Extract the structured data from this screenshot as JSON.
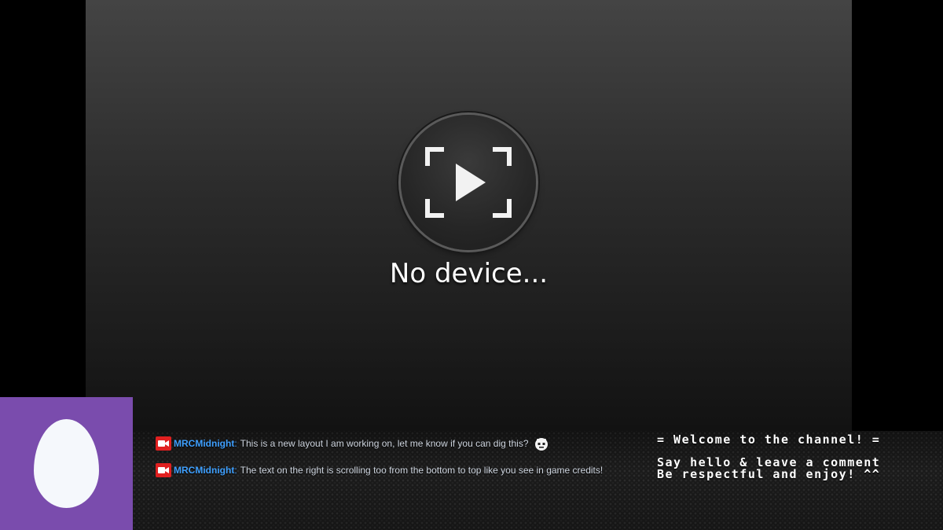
{
  "player": {
    "status_text": "No device..."
  },
  "chat": {
    "messages": [
      {
        "username": "MRCMidnight",
        "separator": ":",
        "text": "This is a new layout I am working on, let me know if you can dig this?",
        "emote": "robot-face-emote"
      },
      {
        "username": "MRCMidnight",
        "separator": ":",
        "text": "The text on the right is scrolling too from the bottom to top like you see in game credits!"
      }
    ]
  },
  "scroller": {
    "line1": "= Welcome to the channel! =",
    "line2": "Say hello & leave a comment",
    "line3": "Be respectful and enjoy! ^^"
  },
  "colors": {
    "webcam_bg": "#7a4cad",
    "username": "#3fa0ff",
    "badge": "#e02020"
  },
  "icons": {
    "play": "play-icon",
    "focus_frame": "focus-frame-icon",
    "camera": "video-camera-icon",
    "avatar": "egg-avatar-icon"
  }
}
